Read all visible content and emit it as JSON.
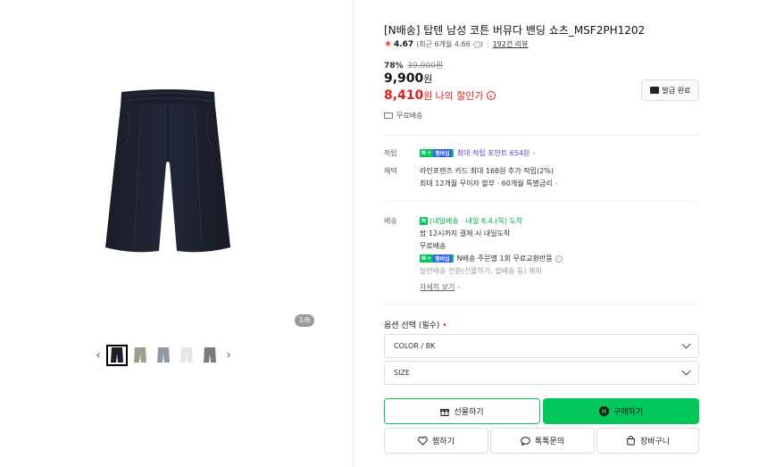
{
  "gallery": {
    "page_counter": "1/6",
    "prev_icon": "chevron-left-icon",
    "next_icon": "chevron-right-icon",
    "thumbnails": [
      {
        "color": "#1c1f2a",
        "selected": true
      },
      {
        "color": "#9aa08a",
        "selected": false
      },
      {
        "color": "#8f98a6",
        "selected": false
      },
      {
        "color": "#e6e6e6",
        "selected": false
      },
      {
        "color": "#7a7c7c",
        "selected": false
      }
    ]
  },
  "product": {
    "title": "[N배송] 탑텐 남성 코튼 버뮤다 밴딩 쇼츠_MSF2PH1202",
    "rating": "4.67",
    "recent_rating": "(최근 6개월 4.66",
    "recent_rating_icon": "info-icon",
    "recent_rating_close": ")",
    "review_count": "192건 리뷰",
    "discount_rate": "78%",
    "original_price": "39,900원",
    "price": "9,900",
    "price_unit": "원",
    "my_price": "8,410",
    "my_price_unit": "원",
    "my_price_label": "나의 할인가",
    "coupon_button": "발급 완료",
    "free_shipping": "무료배송"
  },
  "benefits": {
    "points_label": "적립",
    "points_badge": "N",
    "points_badge_plus": "+",
    "points_badge_tag": "멤버십",
    "points_text": "최대 적립 포인트 654원",
    "benefit_label": "혜택",
    "benefit_line1": "라인프렌즈 카드 최대 168원 추가 적립(2%)",
    "benefit_line2": "최대 12개월 무이자 할부 · 60개월 특별금리"
  },
  "shipping": {
    "label": "배송",
    "delivery_badge": "N",
    "delivery_type": "(내일배송",
    "delivery_date": "· 내일 6.4.(목) 도착",
    "cutoff": "밤 12시까지 결제 시 내일도착",
    "fee": "무료배송",
    "exchange_badge": "N",
    "exchange_badge_plus": "+",
    "exchange_badge_tag": "멤버십",
    "exchange_text": "N배송 주문별 1회 무료교환반품",
    "exclusion": "일반배송 전환(선물하기, 합배송 등) 제외",
    "more_link": "자세히 보기"
  },
  "options": {
    "label": "옵션 선택 (필수)",
    "required_mark": "•",
    "color_select": "COLOR / BK",
    "size_select": "SIZE"
  },
  "actions": {
    "gift": "선물하기",
    "buy_badge": "N",
    "buy": "구매하기",
    "wish": "찜하기",
    "talk": "톡톡문의",
    "cart": "장바구니"
  },
  "colors": {
    "accent_green": "#03c75a",
    "price_red": "#e02020",
    "points_purple": "#5046d6"
  }
}
